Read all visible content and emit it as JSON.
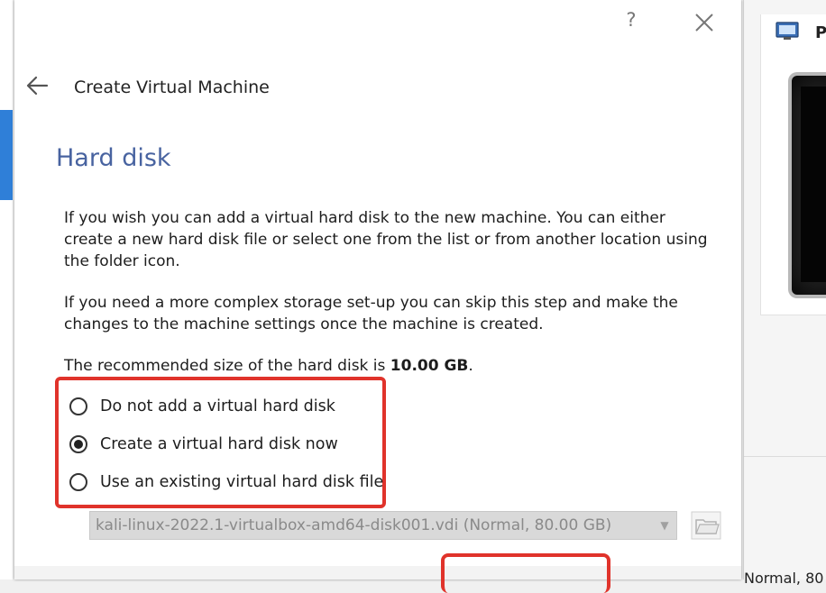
{
  "dialog": {
    "help_label": "?",
    "wizard_title": "Create Virtual Machine",
    "page_heading": "Hard disk",
    "paragraph1": "If you wish you can add a virtual hard disk to the new machine. You can either create a new hard disk file or select one from the list or from another location using the folder icon.",
    "paragraph2": "If you need a more complex storage set-up you can skip this step and make the changes to the machine settings once the machine is created.",
    "recommended_prefix": "The recommended size of the hard disk is ",
    "recommended_size": "10.00 GB",
    "recommended_suffix": ".",
    "options": [
      {
        "label": "Do not add a virtual hard disk",
        "checked": false
      },
      {
        "label": "Create a virtual hard disk now",
        "checked": true
      },
      {
        "label": "Use an existing virtual hard disk file",
        "checked": false
      }
    ],
    "disk_select_value": "kali-linux-2022.1-virtualbox-amd64-disk001.vdi (Normal, 80.00 GB)",
    "icons": {
      "back": "arrow-left-icon",
      "close": "close-icon",
      "dropdown": "chevron-down-icon",
      "folder": "folder-icon"
    }
  },
  "background": {
    "panel_label": "P",
    "snippet_text": "Normal, 80"
  },
  "colors": {
    "heading": "#4863a0",
    "highlight": "#e0332b",
    "accent": "#2f7fd8"
  }
}
